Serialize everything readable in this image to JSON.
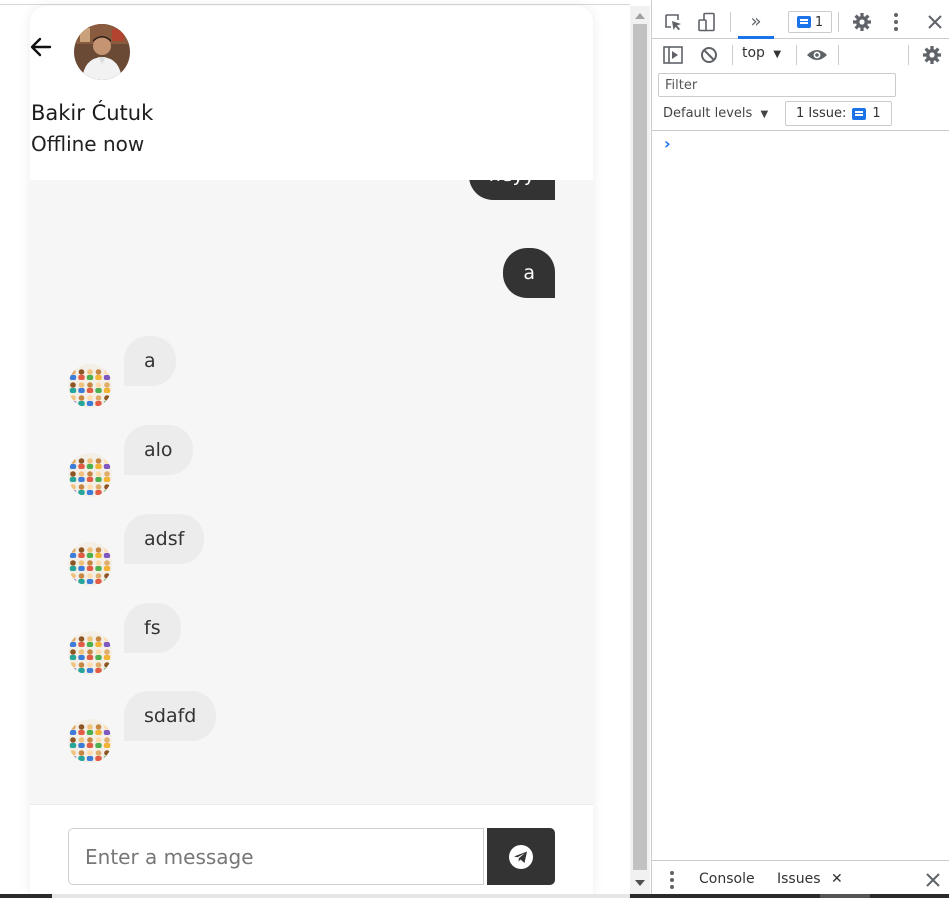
{
  "chat": {
    "contact_name": "Bakir Ćutuk",
    "contact_status": "Offline now",
    "messages": [
      {
        "direction": "out",
        "text": "heyy"
      },
      {
        "direction": "out",
        "text": "a"
      },
      {
        "direction": "in",
        "text": "a"
      },
      {
        "direction": "in",
        "text": "alo"
      },
      {
        "direction": "in",
        "text": "adsf"
      },
      {
        "direction": "in",
        "text": "fs"
      },
      {
        "direction": "in",
        "text": "sdafd"
      }
    ],
    "input_placeholder": "Enter a message",
    "icons": {
      "back": "arrow-left-icon",
      "send": "telegram-send-icon"
    },
    "colors": {
      "bubble_out": "#333333",
      "bubble_in": "#ececec",
      "background": "#f6f6f6"
    }
  },
  "devtools": {
    "badge_count": "1",
    "context": "top",
    "filter_placeholder": "Filter",
    "levels": "Default levels",
    "issue_label": "1 Issue:",
    "issue_count": "1",
    "prompt": "›",
    "drawer_tabs": {
      "console": "Console",
      "issues": "Issues"
    },
    "accent": "#1a73e8"
  }
}
